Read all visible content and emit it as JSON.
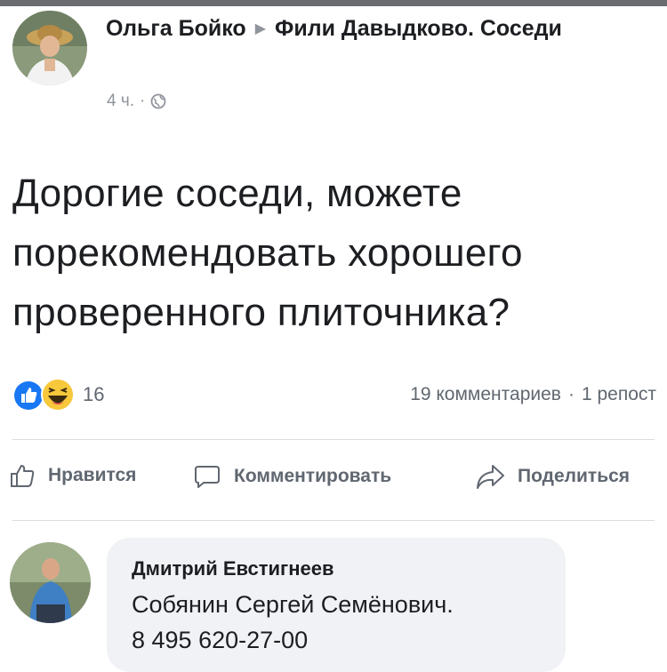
{
  "post": {
    "author": "Ольга Бойко",
    "group": "Фили Давыдково. Соседи",
    "time": "4 ч.",
    "separator": "·",
    "privacy_icon": "globe-icon",
    "text": "Дорогие соседи, можете порекомендовать хорошего проверенного плиточника?"
  },
  "stats": {
    "reactions": [
      "like",
      "haha"
    ],
    "reaction_count": "16",
    "comments": "19 комментариев",
    "shares": "1 репост",
    "separator": "·"
  },
  "actions": {
    "like": "Нравится",
    "comment": "Комментировать",
    "share": "Поделиться"
  },
  "comment": {
    "author": "Дмитрий Евстигнеев",
    "line1": "Собянин Сергей Семёнович.",
    "line2": "8 495 620-27-00"
  },
  "colors": {
    "like_blue": "#1877f2",
    "haha_yellow": "#f7c83b",
    "meta_gray": "#90949c",
    "action_gray": "#606770",
    "bubble": "#f0f2f5"
  }
}
